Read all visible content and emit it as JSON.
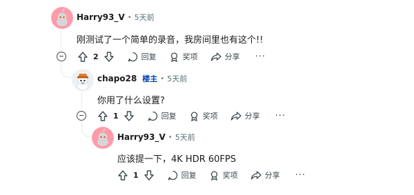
{
  "comments": [
    {
      "author": "Harry93_V",
      "time": "5天前",
      "body": "刚测试了一个简单的录音，我房间里也有这个!!",
      "score": "2"
    },
    {
      "author": "chapo28",
      "badge": "楼主",
      "time": "5天前",
      "body": "你用了什么设置?",
      "score": "1"
    },
    {
      "author": "Harry93_V",
      "time": "5天前",
      "body": "应该提一下，4K HDR 60FPS",
      "score": "1"
    }
  ],
  "actions": {
    "reply": "回复",
    "award": "奖项",
    "share": "分享",
    "more": "···"
  },
  "meta_separator": "•",
  "colors": {
    "avatar_pink": "#ff9aa8",
    "op_badge": "#0045ac",
    "thread_line": "#e5ebee"
  }
}
